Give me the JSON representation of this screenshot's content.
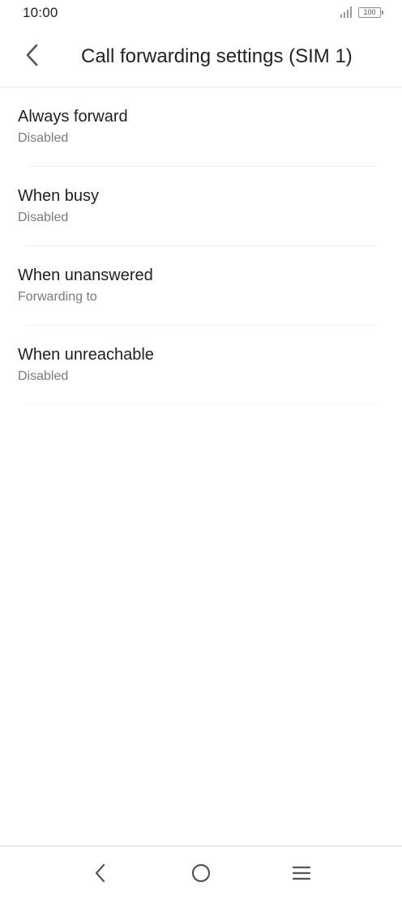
{
  "status_bar": {
    "time": "10:00",
    "battery": "100"
  },
  "header": {
    "title": "Call forwarding settings (SIM 1)"
  },
  "settings": [
    {
      "title": "Always forward",
      "status": "Disabled"
    },
    {
      "title": "When busy",
      "status": "Disabled"
    },
    {
      "title": "When unanswered",
      "status": "Forwarding to"
    },
    {
      "title": "When unreachable",
      "status": "Disabled"
    }
  ],
  "icons": {
    "back": "chevron-left-icon",
    "nav_back": "nav-back-icon",
    "nav_home": "nav-home-icon",
    "nav_menu": "nav-menu-icon",
    "signal": "signal-icon",
    "battery": "battery-icon"
  },
  "colors": {
    "background": "#ffffff",
    "title_text": "#1f1f1f",
    "secondary_text": "#7a7a7a",
    "icon": "#555555"
  }
}
